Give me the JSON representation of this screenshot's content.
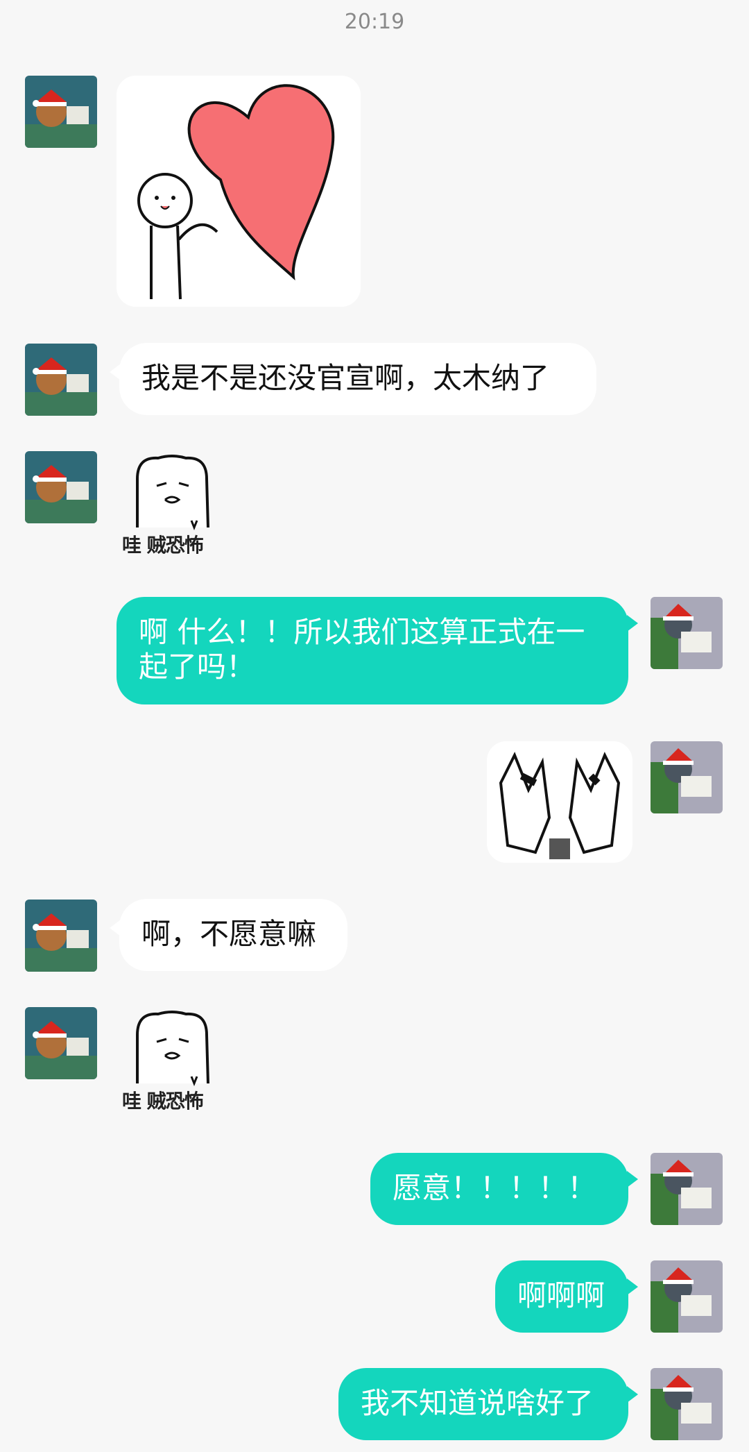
{
  "chat": {
    "timestamp": "20:19",
    "messages": [
      {
        "side": "in",
        "type": "sticker",
        "sticker": "heart-hug-sticker"
      },
      {
        "side": "in",
        "type": "text",
        "text": "我是不是还没官宣啊，太木纳了"
      },
      {
        "side": "in",
        "type": "sticker",
        "sticker": "bear-wow-scary-sticker",
        "caption": "哇 贼恐怖"
      },
      {
        "side": "out",
        "type": "text",
        "text": "啊 什么！！所以我们这算正式在一起了吗！"
      },
      {
        "side": "out",
        "type": "sticker",
        "sticker": "hands-covering-face-sticker"
      },
      {
        "side": "in",
        "type": "text",
        "text": "啊，不愿意嘛"
      },
      {
        "side": "in",
        "type": "sticker",
        "sticker": "bear-wow-scary-sticker",
        "caption": "哇 贼恐怖"
      },
      {
        "side": "out",
        "type": "text",
        "text": "愿意！！！！！"
      },
      {
        "side": "out",
        "type": "text",
        "text": "啊啊啊"
      },
      {
        "side": "out",
        "type": "text",
        "text": "我不知道说啥好了"
      }
    ]
  },
  "colors": {
    "background": "#f7f7f7",
    "outgoing_bubble": "#14d6bd",
    "incoming_bubble": "#ffffff",
    "timestamp": "#8a8a8a"
  },
  "icons": {
    "incoming_avatar": "mouse-santa-hat-avatar",
    "outgoing_avatar": "cat-santa-hat-avatar"
  }
}
